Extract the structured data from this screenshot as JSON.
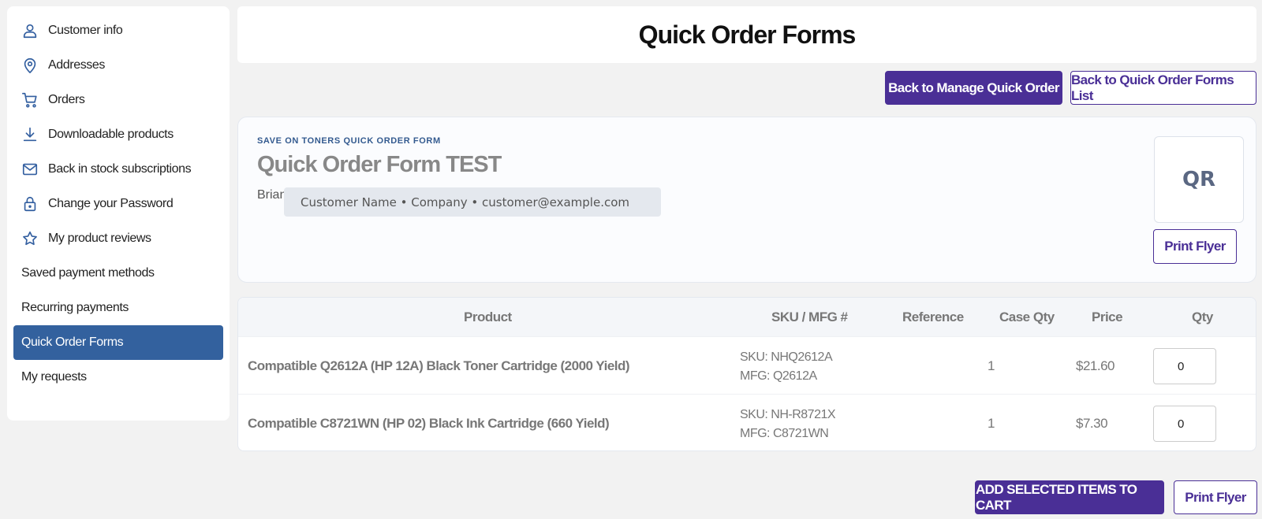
{
  "sidebar": {
    "items": [
      {
        "label": "Customer info",
        "icon": "user-icon"
      },
      {
        "label": "Addresses",
        "icon": "map-pin-icon"
      },
      {
        "label": "Orders",
        "icon": "cart-icon"
      },
      {
        "label": "Downloadable products",
        "icon": "download-icon"
      },
      {
        "label": "Back in stock subscriptions",
        "icon": "envelope-icon"
      },
      {
        "label": "Change your Password",
        "icon": "lock-icon"
      },
      {
        "label": "My product reviews",
        "icon": "star-icon"
      },
      {
        "label": "Saved payment methods",
        "icon": ""
      },
      {
        "label": "Recurring payments",
        "icon": ""
      },
      {
        "label": "Quick Order Forms",
        "icon": "",
        "active": true
      },
      {
        "label": "My requests",
        "icon": ""
      }
    ],
    "active_color": "#33619e",
    "icon_color": "#335fa0"
  },
  "header": {
    "title": "Quick Order Forms"
  },
  "actions": {
    "back_manage": "Back to Manage Quick Order",
    "back_list": "Back to Quick Order Forms List"
  },
  "form_card": {
    "eyebrow": "SAVE ON TONERS QUICK ORDER FORM",
    "title": "Quick Order Form TEST",
    "owner": "Brian",
    "customer_line": "Customer Name • Company • customer@example.com",
    "qr_label": "QR",
    "print_flyer": "Print Flyer"
  },
  "table": {
    "headers": {
      "product": "Product",
      "sku": "SKU / MFG #",
      "reference": "Reference",
      "case_qty": "Case Qty",
      "price": "Price",
      "qty": "Qty"
    },
    "rows": [
      {
        "product": "Compatible Q2612A (HP 12A) Black Toner Cartridge (2000 Yield)",
        "sku": "SKU: NHQ2612A",
        "mfg": "MFG: Q2612A",
        "reference": "",
        "case_qty": "1",
        "price": "$21.60",
        "qty": "0"
      },
      {
        "product": "Compatible C8721WN (HP 02) Black Ink Cartridge (660 Yield)",
        "sku": "SKU: NH-R8721X",
        "mfg": "MFG: C8721WN",
        "reference": "",
        "case_qty": "1",
        "price": "$7.30",
        "qty": "0"
      }
    ]
  },
  "footer": {
    "add_to_cart": "ADD SELECTED ITEMS TO CART",
    "print_flyer": "Print Flyer"
  },
  "colors": {
    "primary": "#4a2f96",
    "background": "#f2f2f2"
  }
}
